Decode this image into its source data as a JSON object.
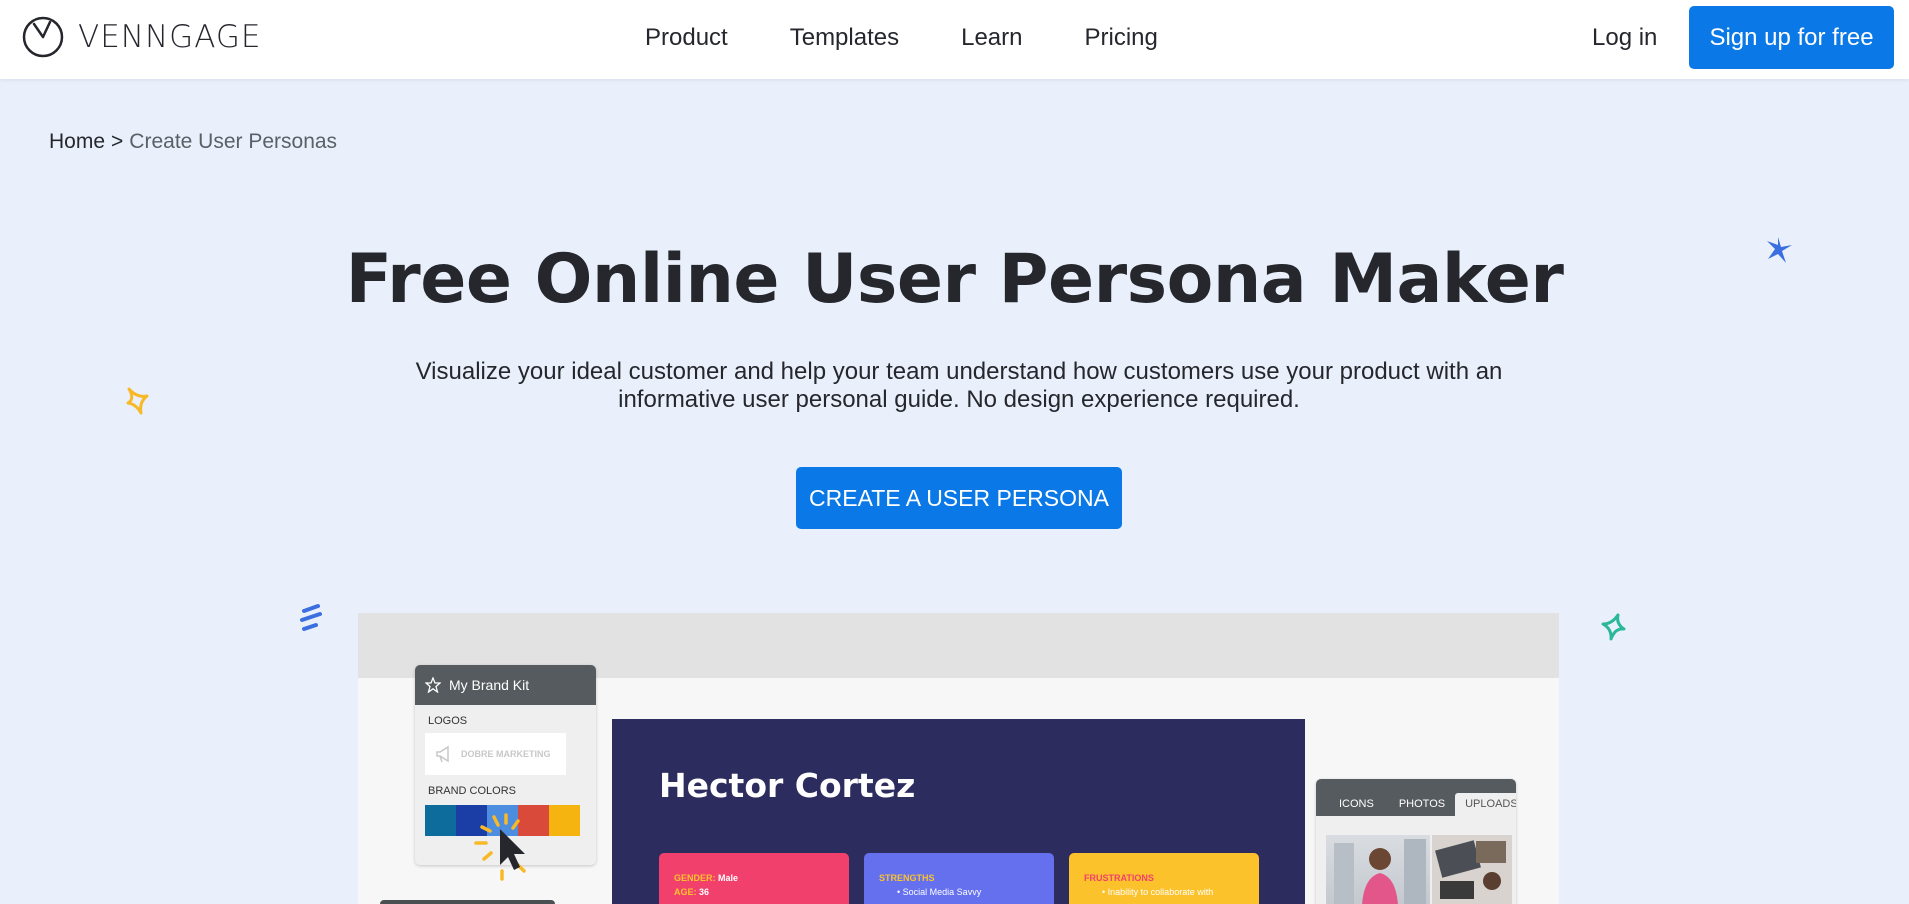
{
  "header": {
    "logo_text": "VENNGAGE",
    "nav": [
      "Product",
      "Templates",
      "Learn",
      "Pricing"
    ],
    "login_label": "Log in",
    "signup_label": "Sign up for free"
  },
  "breadcrumb": {
    "home": "Home",
    "separator": ">",
    "current": "Create User Personas"
  },
  "hero": {
    "title": "Free Online User Persona Maker",
    "subtitle_line1": "Visualize your ideal customer and help your team understand how customers use your product with an",
    "subtitle_line2": "informative user personal guide. No design experience required.",
    "cta_label": "CREATE A USER PERSONA"
  },
  "preview": {
    "brand_kit": {
      "title": "My Brand Kit",
      "logos_label": "LOGOS",
      "logo_text": "DOBRE MARKETING",
      "colors_label": "BRAND COLORS",
      "colors": [
        "#0e6c9c",
        "#1b3ea6",
        "#4c8de0",
        "#d94a3a",
        "#f5b40f"
      ]
    },
    "persona": {
      "name": "Hector Cortez",
      "cards": [
        {
          "heading": "GENDER:",
          "value": "Male",
          "heading2": "AGE:",
          "value2": "36",
          "color": "#f2406c"
        },
        {
          "heading": "STRENGTHS",
          "value": "Social Media Savvy",
          "color": "#6470ee"
        },
        {
          "heading": "FRUSTRATIONS",
          "value": "Inability to collaborate with",
          "color": "#fcc22c"
        }
      ]
    },
    "asset_tabs": [
      "ICONS",
      "PHOTOS",
      "UPLOADS"
    ]
  },
  "colors": {
    "primary": "#0a78e6",
    "background": "#eaf0fb",
    "text": "#25272d"
  }
}
